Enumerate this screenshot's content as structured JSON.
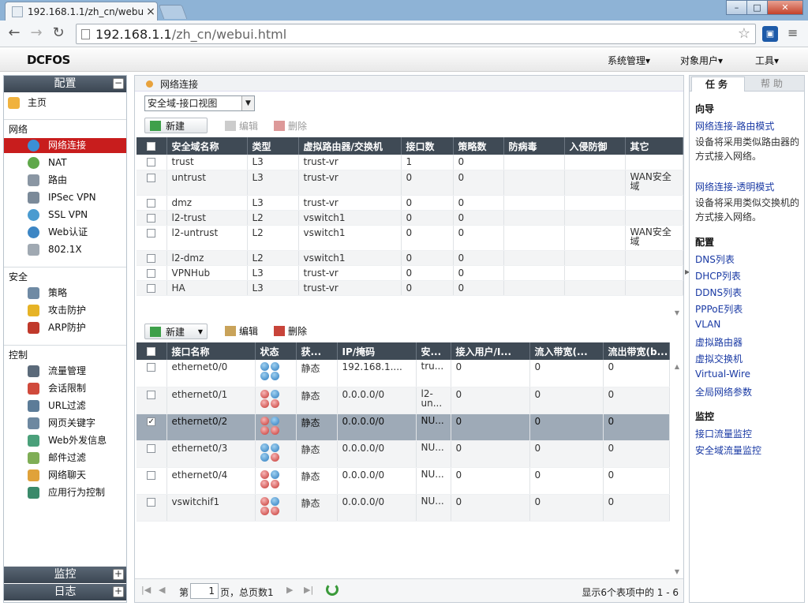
{
  "browser": {
    "tab_title": "192.168.1.1/zh_cn/webu",
    "tab_close": "×",
    "url_host": "192.168.1.1",
    "url_path": "/zh_cn/webui.html"
  },
  "app": {
    "logo": "DCFOS",
    "menus": [
      "系统管理▾",
      "对象用户▾",
      "工具▾"
    ]
  },
  "left": {
    "config_title": "配置",
    "home": "主页",
    "sect_network": "网络",
    "network_items": [
      "网络连接",
      "NAT",
      "路由",
      "IPSec VPN",
      "SSL VPN",
      "Web认证",
      "802.1X"
    ],
    "sect_security": "安全",
    "security_items": [
      "策略",
      "攻击防护",
      "ARP防护"
    ],
    "sect_control": "控制",
    "control_items": [
      "流量管理",
      "会话限制",
      "URL过滤",
      "网页关键字",
      "Web外发信息",
      "邮件过滤",
      "网络聊天",
      "应用行为控制"
    ],
    "monitor_title": "监控",
    "log_title": "日志"
  },
  "center": {
    "breadcrumb": "网络连接",
    "view_select": "安全域-接口视图",
    "zone_toolbar": {
      "new": "新建",
      "edit": "编辑",
      "delete": "删除"
    },
    "zone_columns": [
      "安全域名称",
      "类型",
      "虚拟路由器/交换机",
      "接口数",
      "策略数",
      "防病毒",
      "入侵防御",
      "其它"
    ],
    "zones": [
      {
        "name": "trust",
        "type": "L3",
        "vr": "trust-vr",
        "ifs": "1",
        "policies": "0",
        "other": ""
      },
      {
        "name": "untrust",
        "type": "L3",
        "vr": "trust-vr",
        "ifs": "0",
        "policies": "0",
        "other": "WAN安全域"
      },
      {
        "name": "dmz",
        "type": "L3",
        "vr": "trust-vr",
        "ifs": "0",
        "policies": "0",
        "other": ""
      },
      {
        "name": "l2-trust",
        "type": "L2",
        "vr": "vswitch1",
        "ifs": "0",
        "policies": "0",
        "other": ""
      },
      {
        "name": "l2-untrust",
        "type": "L2",
        "vr": "vswitch1",
        "ifs": "0",
        "policies": "0",
        "other": "WAN安全域"
      },
      {
        "name": "l2-dmz",
        "type": "L2",
        "vr": "vswitch1",
        "ifs": "0",
        "policies": "0",
        "other": ""
      },
      {
        "name": "VPNHub",
        "type": "L3",
        "vr": "trust-vr",
        "ifs": "0",
        "policies": "0",
        "other": ""
      },
      {
        "name": "HA",
        "type": "L3",
        "vr": "trust-vr",
        "ifs": "0",
        "policies": "0",
        "other": ""
      }
    ],
    "if_toolbar": {
      "new": "新建",
      "edit": "编辑",
      "delete": "删除"
    },
    "if_columns": [
      "接口名称",
      "状态",
      "获...",
      "IP/掩码",
      "安...",
      "接入用户/I...",
      "流入带宽(...",
      "流出带宽(b..."
    ],
    "interfaces": [
      {
        "name": "ethernet0/0",
        "status": [
          "up",
          "up",
          "up",
          "up"
        ],
        "mode": "静态",
        "ip": "192.168.1....",
        "zone": "tru...",
        "users": "0",
        "in": "0",
        "out": "0",
        "checked": false
      },
      {
        "name": "ethernet0/1",
        "status": [
          "down",
          "up",
          "down",
          "down"
        ],
        "mode": "静态",
        "ip": "0.0.0.0/0",
        "zone": "l2-un...",
        "users": "0",
        "in": "0",
        "out": "0",
        "checked": false
      },
      {
        "name": "ethernet0/2",
        "status": [
          "down",
          "up",
          "down",
          "down"
        ],
        "mode": "静态",
        "ip": "0.0.0.0/0",
        "zone": "NU...",
        "users": "0",
        "in": "0",
        "out": "0",
        "checked": true
      },
      {
        "name": "ethernet0/3",
        "status": [
          "up",
          "up",
          "up",
          "down"
        ],
        "mode": "静态",
        "ip": "0.0.0.0/0",
        "zone": "NU...",
        "users": "0",
        "in": "0",
        "out": "0",
        "checked": false
      },
      {
        "name": "ethernet0/4",
        "status": [
          "down",
          "up",
          "down",
          "down"
        ],
        "mode": "静态",
        "ip": "0.0.0.0/0",
        "zone": "NU...",
        "users": "0",
        "in": "0",
        "out": "0",
        "checked": false
      },
      {
        "name": "vswitchif1",
        "status": [
          "down",
          "up",
          "down",
          "down"
        ],
        "mode": "静态",
        "ip": "0.0.0.0/0",
        "zone": "NU...",
        "users": "0",
        "in": "0",
        "out": "0",
        "checked": false
      }
    ],
    "pager": {
      "prefix": "第",
      "page": "1",
      "suffix": "页，总页数1",
      "summary": "显示6个表项中的 1 - 6"
    }
  },
  "right": {
    "tab_task": "任务",
    "tab_help": "帮助",
    "wizard_title": "向导",
    "wizard_link1": "网络连接-路由模式",
    "wizard_desc1": "设备将采用类似路由器的方式接入网络。",
    "wizard_link2": "网络连接-透明模式",
    "wizard_desc2": "设备将采用类似交换机的方式接入网络。",
    "config_title": "配置",
    "config_links": [
      "DNS列表",
      "DHCP列表",
      "DDNS列表",
      "PPPoE列表",
      "VLAN",
      "虚拟路由器",
      "虚拟交换机",
      "Virtual-Wire",
      "全局网络参数"
    ],
    "monitor_title": "监控",
    "monitor_links": [
      "接口流量监控",
      "安全域流量监控"
    ]
  },
  "colors": {
    "accent_red": "#c81d1d",
    "header_dark": "#3f4a55",
    "link_blue": "#1a3aa4",
    "status_up": "#2b7bbf",
    "status_down": "#c4342f"
  }
}
